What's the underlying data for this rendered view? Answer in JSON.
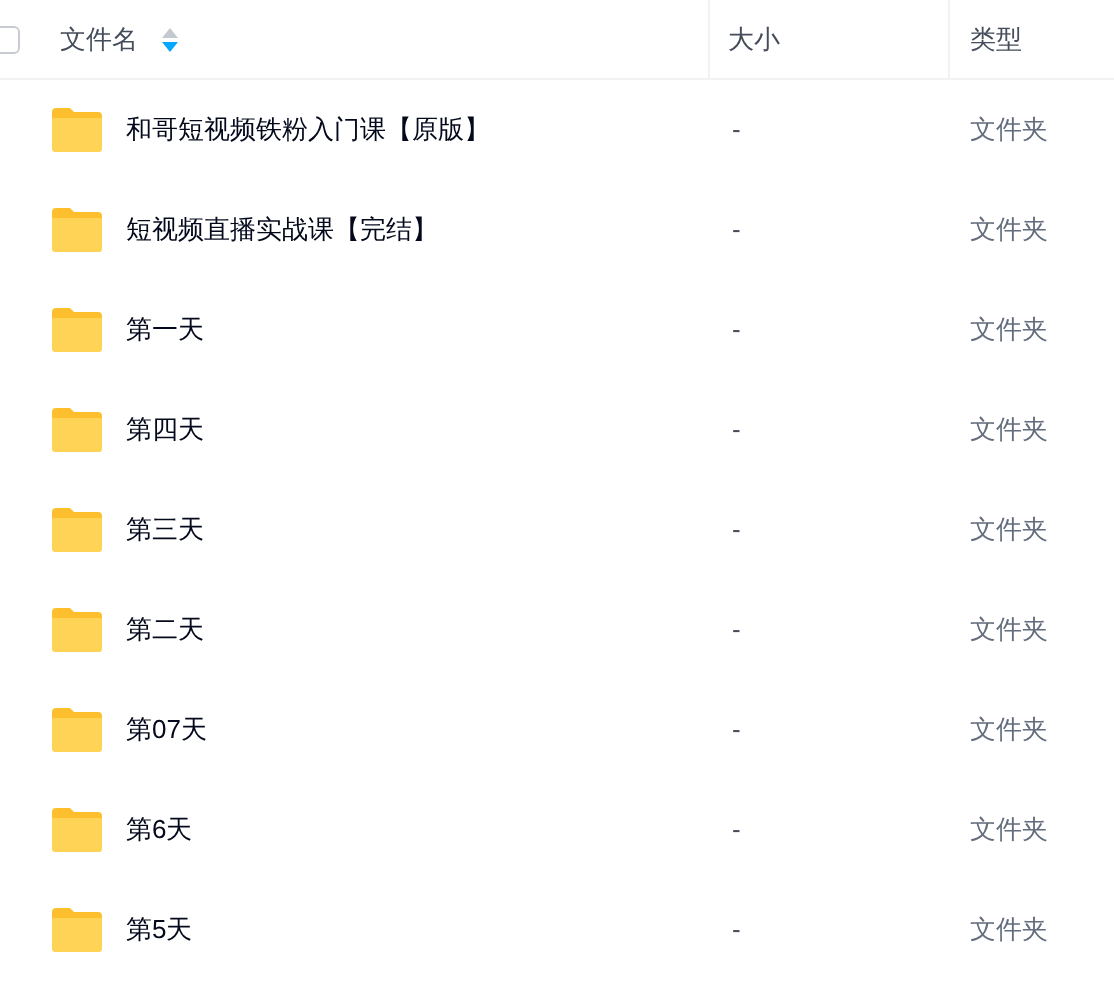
{
  "header": {
    "checked": false,
    "columns": [
      {
        "label": "文件名",
        "sorted_descending": true
      },
      {
        "label": "大小"
      },
      {
        "label": "类型"
      }
    ]
  },
  "rows": [
    {
      "name": "和哥短视频铁粉入门课【原版】",
      "size": "-",
      "type": "文件夹"
    },
    {
      "name": "短视频直播实战课【完结】",
      "size": "-",
      "type": "文件夹"
    },
    {
      "name": "第一天",
      "size": "-",
      "type": "文件夹"
    },
    {
      "name": "第四天",
      "size": "-",
      "type": "文件夹"
    },
    {
      "name": "第三天",
      "size": "-",
      "type": "文件夹"
    },
    {
      "name": "第二天",
      "size": "-",
      "type": "文件夹"
    },
    {
      "name": "第07天",
      "size": "-",
      "type": "文件夹"
    },
    {
      "name": "第6天",
      "size": "-",
      "type": "文件夹"
    },
    {
      "name": "第5天",
      "size": "-",
      "type": "文件夹"
    }
  ]
}
